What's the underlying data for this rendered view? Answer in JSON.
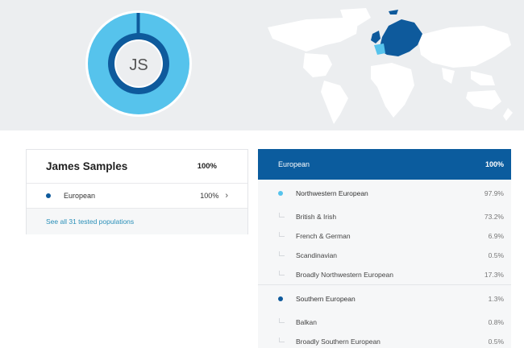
{
  "hero": {
    "avatar_initials": "JS",
    "ring_percent": 100,
    "colors": {
      "outer_ring": "#56c3ec",
      "inner_ring": "#0e5a9c",
      "highlight": "#0b5c9e"
    }
  },
  "summary": {
    "name": "James Samples",
    "percent": "100%",
    "rows": [
      {
        "label": "European",
        "percent": "100%",
        "chevron": "›"
      }
    ],
    "see_all_link": "See all 31 tested populations"
  },
  "detail": {
    "header": {
      "label": "European",
      "percent": "100%"
    },
    "groups": [
      {
        "label": "Northwestern European",
        "percent": "97.9%",
        "dot": "light",
        "children": [
          {
            "label": "British & Irish",
            "percent": "73.2%"
          },
          {
            "label": "French & German",
            "percent": "6.9%"
          },
          {
            "label": "Scandinavian",
            "percent": "0.5%"
          },
          {
            "label": "Broadly Northwestern European",
            "percent": "17.3%"
          }
        ]
      },
      {
        "label": "Southern European",
        "percent": "1.3%",
        "dot": "dark",
        "children": [
          {
            "label": "Balkan",
            "percent": "0.8%"
          },
          {
            "label": "Broadly Southern European",
            "percent": "0.5%"
          }
        ]
      }
    ]
  }
}
